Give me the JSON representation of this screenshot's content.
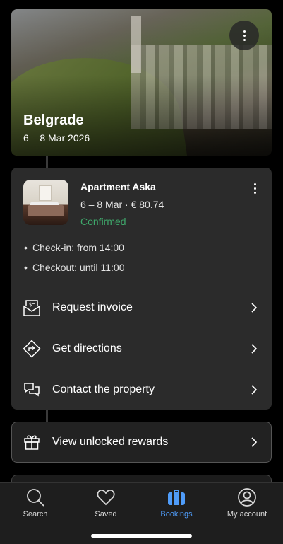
{
  "hero": {
    "city": "Belgrade",
    "dates": "6 – 8 Mar 2026",
    "menu_icon": "more-vertical-icon"
  },
  "booking": {
    "property_name": "Apartment Aska",
    "dates_price": "6 – 8 Mar · € 80.74",
    "status": "Confirmed",
    "status_color": "#3fa86b",
    "check_in": "Check-in: from 14:00",
    "check_out": "Checkout: until 11:00",
    "actions": [
      {
        "label": "Request invoice",
        "icon": "invoice-icon"
      },
      {
        "label": "Get directions",
        "icon": "directions-icon"
      },
      {
        "label": "Contact the property",
        "icon": "chat-icon"
      }
    ]
  },
  "rewards": {
    "label": "View unlocked rewards",
    "icon": "gift-icon"
  },
  "tabs": [
    {
      "label": "Search",
      "icon": "search-icon",
      "active": false
    },
    {
      "label": "Saved",
      "icon": "heart-icon",
      "active": false
    },
    {
      "label": "Bookings",
      "icon": "suitcase-icon",
      "active": true
    },
    {
      "label": "My account",
      "icon": "account-icon",
      "active": false
    }
  ],
  "colors": {
    "accent": "#4f9cf9",
    "card": "#2b2b2b",
    "background": "#000000"
  }
}
